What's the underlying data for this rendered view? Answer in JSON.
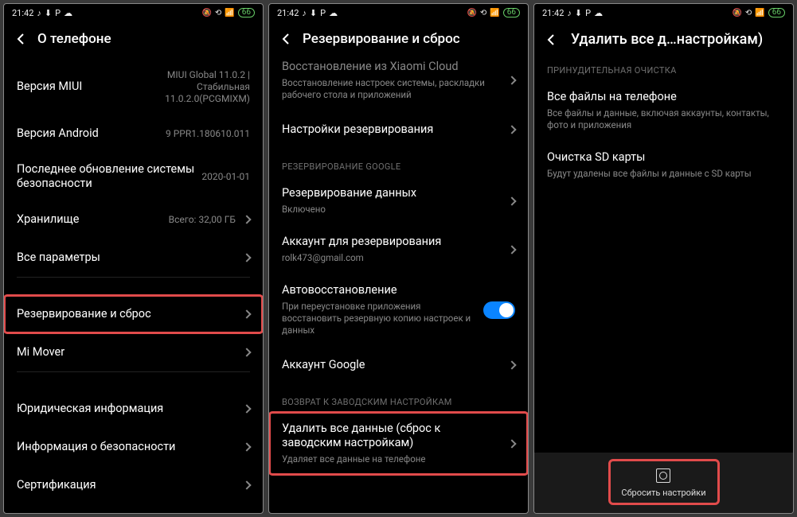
{
  "statusbar": {
    "time": "21:42",
    "battery": "66"
  },
  "screen1": {
    "title": "О телефоне",
    "rows": {
      "miui": {
        "label": "Версия MIUI",
        "value": "MIUI Global 11.0.2 | Стабильная 11.0.2.0(PCGMIXM)"
      },
      "android": {
        "label": "Версия Android",
        "value": "9 PPR1.180610.011"
      },
      "security": {
        "label": "Последнее обновление системы безопасности",
        "value": "2020-01-01"
      },
      "storage": {
        "label": "Хранилище",
        "value": "Всего: 32,00 ГБ"
      },
      "allspecs": {
        "label": "Все параметры"
      },
      "backup": {
        "label": "Резервирование и сброс"
      },
      "mimover": {
        "label": "Mi Mover"
      },
      "legal": {
        "label": "Юридическая информация"
      },
      "safety": {
        "label": "Информация о безопасности"
      },
      "cert": {
        "label": "Сертификация"
      }
    }
  },
  "screen2": {
    "title": "Резервирование и сброс",
    "rows": {
      "xiaomi": {
        "label": "Восстановление из Xiaomi Cloud",
        "sub": "Восстановление настроек системы, раскладки рабочего стола и приложений"
      },
      "backupSettings": {
        "label": "Настройки резервирования"
      },
      "section_google": "РЕЗЕРВИРОВАНИЕ GOOGLE",
      "dataBackup": {
        "label": "Резервирование данных",
        "sub": "Включено"
      },
      "account": {
        "label": "Аккаунт для резервирования",
        "sub": "rolk473@gmail.com"
      },
      "autorestore": {
        "label": "Автовосстановление",
        "sub": "При переустановке приложения восстановить резервную копию настроек и данных"
      },
      "googleAcct": {
        "label": "Аккаунт Google"
      },
      "section_factory": "ВОЗВРАТ К ЗАВОДСКИМ НАСТРОЙКАМ",
      "erase": {
        "label": "Удалить все данные (сброс к заводским настройкам)",
        "sub": "Удаляет все данные на телефоне"
      }
    }
  },
  "screen3": {
    "title": "Удалить все д…настройкам)",
    "section_force": "ПРИНУДИТЕЛЬНАЯ ОЧИСТКА",
    "rows": {
      "allfiles": {
        "label": "Все файлы на телефоне",
        "sub": "Все файлы и данные, включая аккаунты, контакты, фото и приложения"
      },
      "sdcard": {
        "label": "Очистка SD карты",
        "sub": "Будут удалены все файлы и данные с SD карты"
      }
    },
    "reset_button": "Сбросить настройки"
  }
}
